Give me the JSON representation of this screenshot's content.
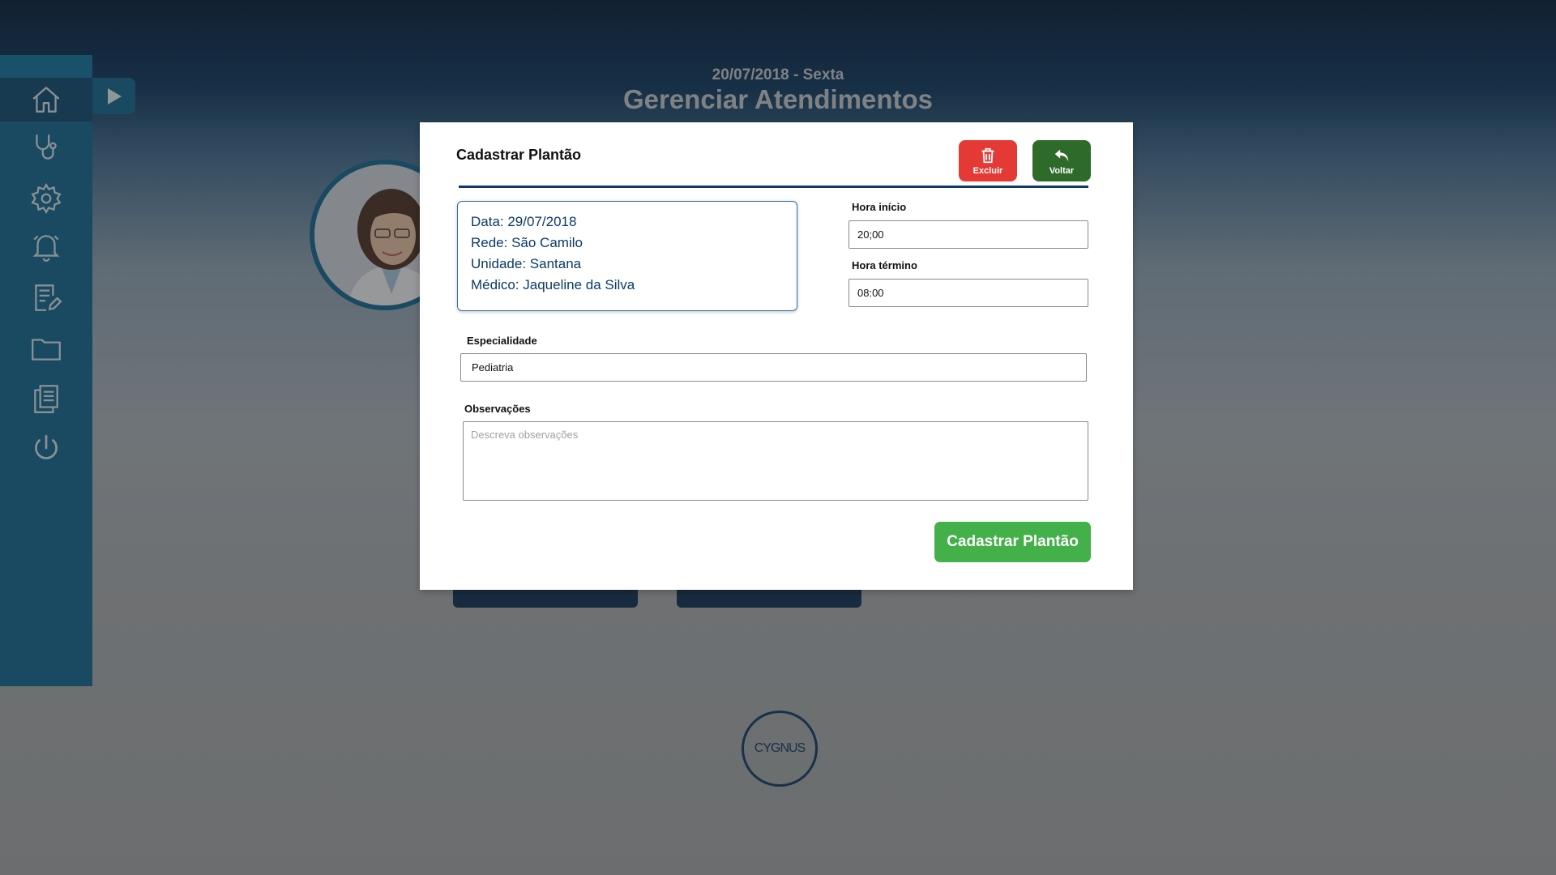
{
  "header": {
    "date": "20/07/2018 - Sexta",
    "title": "Gerenciar Atendimentos"
  },
  "sidebar": {
    "items": [
      {
        "icon": "home-icon"
      },
      {
        "icon": "stethoscope-icon"
      },
      {
        "icon": "gear-icon"
      },
      {
        "icon": "bell-icon"
      },
      {
        "icon": "edit-document-icon"
      },
      {
        "icon": "folder-icon"
      },
      {
        "icon": "documents-icon"
      },
      {
        "icon": "power-icon"
      }
    ]
  },
  "logo": {
    "text": "CYGNUS"
  },
  "modal": {
    "title": "Cadastrar Plantão",
    "delete_label": "Excluir",
    "back_label": "Voltar",
    "info": {
      "date": "Data: 29/07/2018",
      "network": "Rede: São Camilo",
      "unit": "Unidade: Santana",
      "doctor": "Médico: Jaqueline da Silva"
    },
    "start_time": {
      "label": "Hora início",
      "value": "20;00"
    },
    "end_time": {
      "label": "Hora término",
      "value": "08:00"
    },
    "specialty": {
      "label": "Especialidade",
      "value": "Pediatria"
    },
    "notes": {
      "label": "Observações",
      "placeholder": "Descreva observações",
      "value": ""
    },
    "submit_label": "Cadastrar Plantão"
  },
  "colors": {
    "sidebar": "#0e6691",
    "delete": "#e53935",
    "back": "#2e6b2a",
    "submit": "#43b049",
    "navy": "#0b3a66"
  }
}
